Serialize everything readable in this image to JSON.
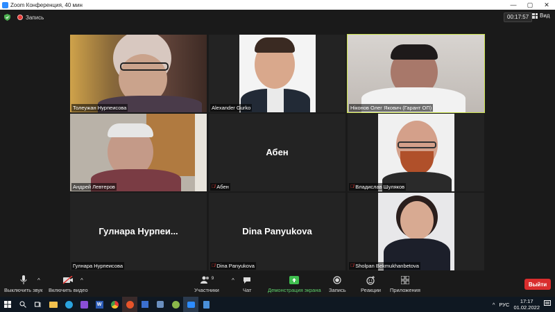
{
  "window": {
    "title": "Zoom Конференция, 40 мин"
  },
  "topbar": {
    "recording_label": "Запись",
    "timer": "00:17:57",
    "view_label": "Вид"
  },
  "participants": [
    {
      "name": "Толеужан Нурпеисова",
      "muted": false,
      "video": true
    },
    {
      "name": "Alexander Gurko",
      "muted": false,
      "video": true
    },
    {
      "name": "Ніконов Олег Якович (Гарант ОП)",
      "muted": false,
      "video": true,
      "active_speaker": true
    },
    {
      "name": "Андрей Левтеров",
      "muted": false,
      "video": true
    },
    {
      "name": "Абен",
      "display": "Абен",
      "muted": true,
      "video": false
    },
    {
      "name": "Владислав Шуляков",
      "muted": true,
      "video": true
    },
    {
      "name": "Гулнара Нурпеисова",
      "display": "Гулнара  Нурпеи...",
      "muted": false,
      "video": false
    },
    {
      "name": "Dina Panyukova",
      "display": "Dina Panyukova",
      "muted": true,
      "video": false
    },
    {
      "name": "Sholpan Bekmukhanbetova",
      "muted": true,
      "video": true
    }
  ],
  "toolbar": {
    "mute": "Выключить звук",
    "video": "Включить видео",
    "participants": "Участники",
    "participants_count": "9",
    "chat": "Чат",
    "share": "Демонстрация экрана",
    "record": "Запись",
    "reactions": "Реакции",
    "apps": "Приложения",
    "leave": "Выйти"
  },
  "taskbar": {
    "lang": "РУС",
    "time": "17:17",
    "date": "01.02.2022"
  }
}
